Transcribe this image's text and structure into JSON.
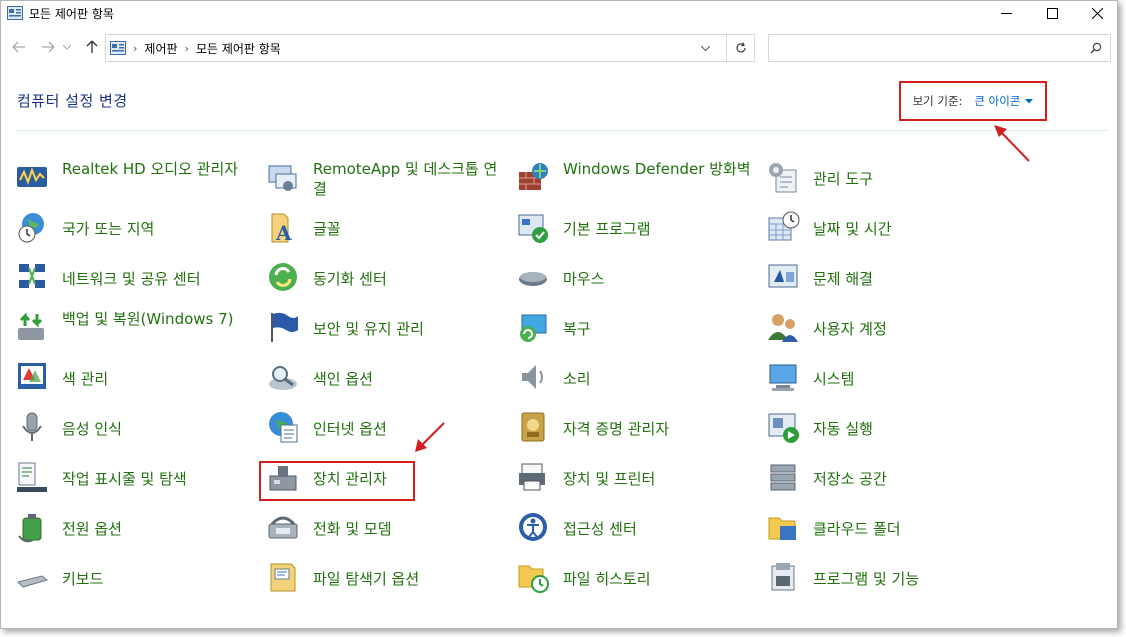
{
  "window": {
    "title": "모든 제어판 항목"
  },
  "address": {
    "crumbs": [
      "제어판",
      "모든 제어판 항목"
    ],
    "search_placeholder": ""
  },
  "header": {
    "title": "컴퓨터 설정 변경",
    "view_by_label": "보기 기준:",
    "view_by_value": "큰 아이콘"
  },
  "items": [
    {
      "label": "Realtek HD 오디오 관리자",
      "icon": "realtek-audio-icon"
    },
    {
      "label": "RemoteApp 및 데스크톱 연결",
      "icon": "remoteapp-icon"
    },
    {
      "label": "Windows Defender 방화벽",
      "icon": "firewall-icon"
    },
    {
      "label": "관리 도구",
      "icon": "admin-tools-icon"
    },
    {
      "label": "국가 또는 지역",
      "icon": "region-icon"
    },
    {
      "label": "글꼴",
      "icon": "fonts-icon"
    },
    {
      "label": "기본 프로그램",
      "icon": "default-programs-icon"
    },
    {
      "label": "날짜 및 시간",
      "icon": "date-time-icon"
    },
    {
      "label": "네트워크 및 공유 센터",
      "icon": "network-icon"
    },
    {
      "label": "동기화 센터",
      "icon": "sync-icon"
    },
    {
      "label": "마우스",
      "icon": "mouse-icon"
    },
    {
      "label": "문제 해결",
      "icon": "troubleshoot-icon"
    },
    {
      "label": "백업 및 복원(Windows 7)",
      "icon": "backup-icon"
    },
    {
      "label": "보안 및 유지 관리",
      "icon": "security-flag-icon"
    },
    {
      "label": "복구",
      "icon": "recovery-icon"
    },
    {
      "label": "사용자 계정",
      "icon": "user-accounts-icon"
    },
    {
      "label": "색 관리",
      "icon": "color-management-icon"
    },
    {
      "label": "색인 옵션",
      "icon": "indexing-icon"
    },
    {
      "label": "소리",
      "icon": "sound-icon"
    },
    {
      "label": "시스템",
      "icon": "system-icon"
    },
    {
      "label": "음성 인식",
      "icon": "microphone-icon"
    },
    {
      "label": "인터넷 옵션",
      "icon": "internet-options-icon"
    },
    {
      "label": "자격 증명 관리자",
      "icon": "credential-icon"
    },
    {
      "label": "자동 실행",
      "icon": "autoplay-icon"
    },
    {
      "label": "작업 표시줄 및 탐색",
      "icon": "taskbar-icon"
    },
    {
      "label": "장치 관리자",
      "icon": "device-manager-icon"
    },
    {
      "label": "장치 및 프린터",
      "icon": "printer-icon"
    },
    {
      "label": "저장소 공간",
      "icon": "storage-icon"
    },
    {
      "label": "전원 옵션",
      "icon": "power-icon"
    },
    {
      "label": "전화 및 모뎀",
      "icon": "phone-modem-icon"
    },
    {
      "label": "접근성 센터",
      "icon": "accessibility-icon"
    },
    {
      "label": "클라우드 폴더",
      "icon": "cloud-folder-icon"
    },
    {
      "label": "키보드",
      "icon": "keyboard-icon"
    },
    {
      "label": "파일 탐색기 옵션",
      "icon": "folder-options-icon"
    },
    {
      "label": "파일 히스토리",
      "icon": "file-history-icon"
    },
    {
      "label": "프로그램 및 기능",
      "icon": "programs-icon"
    }
  ],
  "colors": {
    "link": "#21710f",
    "title": "#1e3287",
    "highlight": "#d21e1e",
    "viewby_value": "#0066cc"
  }
}
